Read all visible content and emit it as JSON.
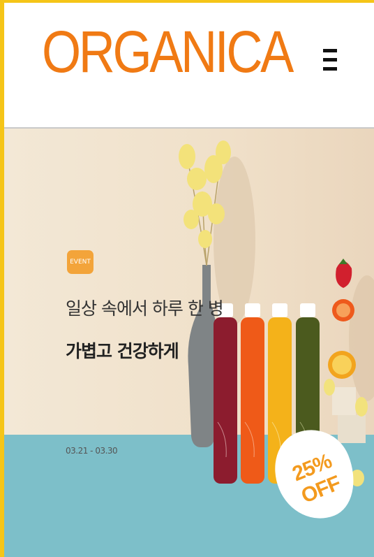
{
  "header": {
    "logo": "ORGANICA",
    "menu_icon": "hamburger-menu-icon"
  },
  "hero": {
    "badge": "EVENT",
    "headline_line1": "일상 속에서 하루 한 병",
    "headline_line2": "가볍고 건강하게",
    "date_range": "03.21 - 03.30",
    "discount": "25% OFF"
  },
  "colors": {
    "brand": "#f07a14",
    "frame": "#f5c518",
    "badge": "#f3a43a",
    "wall": "#f0e3cf",
    "table": "#7dbfc9",
    "discount_text": "#f39a1e"
  }
}
